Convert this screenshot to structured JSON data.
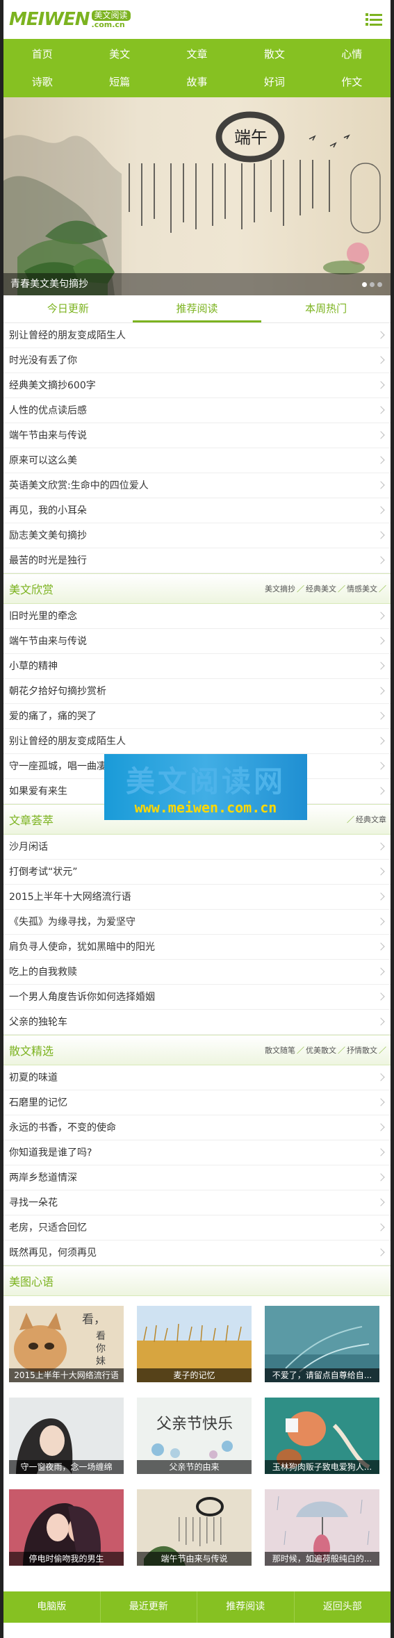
{
  "header": {
    "logo_word": "MEIWEN",
    "logo_cn": "美文阅读",
    "logo_domain": ".com.cn"
  },
  "nav": [
    "首页",
    "美文",
    "文章",
    "散文",
    "心情",
    "诗歌",
    "短篇",
    "故事",
    "好词",
    "作文"
  ],
  "banner": {
    "title_chars": "端午",
    "caption": "青春美文美句摘抄",
    "slide_count": 3,
    "active_slide": 1
  },
  "tabs": [
    "今日更新",
    "推荐阅读",
    "本周热门"
  ],
  "active_tab": "推荐阅读",
  "list_main": [
    "别让曾经的朋友变成陌生人",
    "时光没有丢了你",
    "经典美文摘抄600字",
    "人性的优点读后感",
    "端午节由来与传说",
    "原来可以这么美",
    "英语美文欣赏:生命中的四位爱人",
    "再见，我的小耳朵",
    "励志美文美句摘抄",
    "最苦的时光是独行"
  ],
  "sections": [
    {
      "title": "美文欣赏",
      "links": [
        "美文摘抄",
        "经典美文",
        "情感美文"
      ],
      "items": [
        "旧时光里的牵念",
        "端午节由来与传说",
        "小草的精神",
        "朝花夕拾好句摘抄赏析",
        "爱的痛了，痛的哭了",
        "别让曾经的朋友变成陌生人",
        "守一座孤城，唱一曲凄凉",
        "如果爱有来生"
      ]
    },
    {
      "title": "文章荟萃",
      "links": [
        "经典文章"
      ],
      "items": [
        "沙月闲话",
        "打倒考试“状元”",
        "2015上半年十大网络流行语",
        "《失孤》为缘寻找，为爱坚守",
        "肩负寻人使命，犹如黑暗中的阳光",
        "吃上的自我救赎",
        "一个男人角度告诉你如何选择婚姻",
        "父亲的独轮车"
      ]
    },
    {
      "title": "散文精选",
      "links": [
        "散文随笔",
        "优美散文",
        "抒情散文"
      ],
      "items": [
        "初夏的味道",
        "石磨里的记忆",
        "永远的书香，不变的使命",
        "你知道我是谁了吗?",
        "两岸乡愁道情深",
        "寻找一朵花",
        "老房，只适合回忆",
        "既然再见，何须再见"
      ]
    }
  ],
  "gallery": {
    "title": "美图心语",
    "items": [
      {
        "caption": "2015上半年十大网络流行语",
        "art": "cat-text-image"
      },
      {
        "caption": "麦子的记忆",
        "art": "wheat-field-image"
      },
      {
        "caption": "不爱了，请留点自尊给自...",
        "art": "dandelion-image"
      },
      {
        "caption": "守一窗夜雨，念一场缠绵",
        "art": "girl-profile-image"
      },
      {
        "caption": "父亲节的由来",
        "art": "fathers-day-image"
      },
      {
        "caption": "玉林狗肉贩子致电爱狗人...",
        "art": "cartoon-dog-image"
      },
      {
        "caption": "停电时偷吻我的男生",
        "art": "couple-kiss-image"
      },
      {
        "caption": "端午节由来与传说",
        "art": "dragon-boat-image"
      },
      {
        "caption": "那时候，如遍荷般纯白的...",
        "art": "umbrella-girl-image"
      }
    ],
    "cat_text": [
      "看，",
      "看",
      "你",
      "妹"
    ],
    "fathers_day_title": "父亲节快乐"
  },
  "watermark": {
    "top": "美文阅读网",
    "url": "www.meiwen.com.cn"
  },
  "footer": [
    "电脑版",
    "最近更新",
    "推荐阅读",
    "返回头部"
  ],
  "colors": {
    "accent": "#7cb320",
    "nav_bg": "#86c122"
  }
}
